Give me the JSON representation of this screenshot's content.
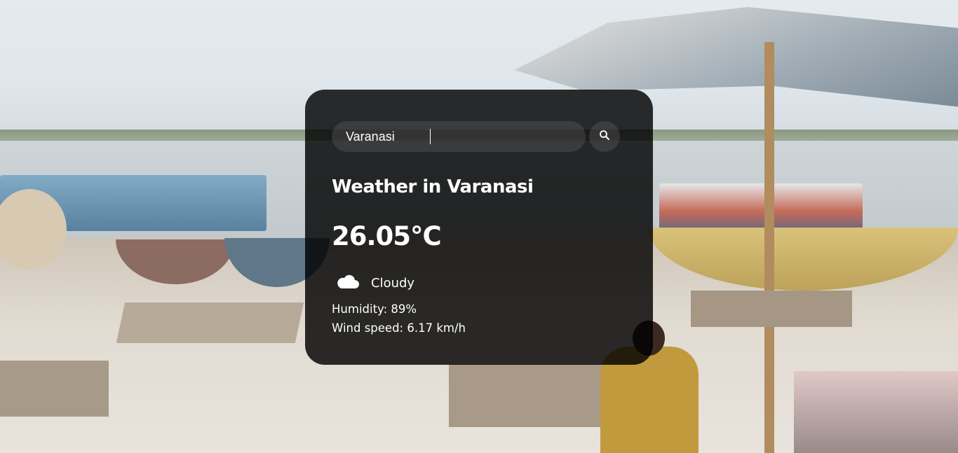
{
  "search": {
    "value": "Varanasi",
    "button_icon": "search-icon"
  },
  "weather": {
    "title": "Weather in Varanasi",
    "temperature": "26.05°C",
    "condition_icon": "cloud-icon",
    "condition": "Cloudy",
    "humidity": "Humidity: 89%",
    "wind": "Wind speed: 6.17 km/h"
  },
  "colors": {
    "card_background": "#000000",
    "text": "#ffffff",
    "input_background": "#7c7c7c"
  }
}
